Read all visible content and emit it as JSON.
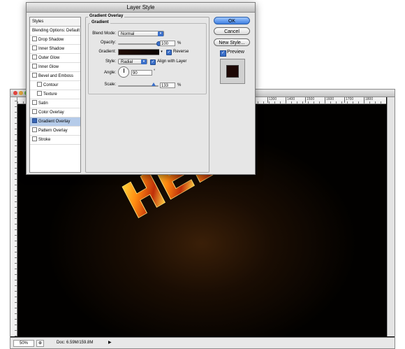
{
  "dialog": {
    "title": "Layer Style",
    "styles_header": "Styles",
    "styles": [
      {
        "label": "Blending Options: Default",
        "checkbox": false,
        "sub": false,
        "selected": false,
        "checked": false
      },
      {
        "label": "Drop Shadow",
        "checkbox": true,
        "sub": false,
        "selected": false,
        "checked": false
      },
      {
        "label": "Inner Shadow",
        "checkbox": true,
        "sub": false,
        "selected": false,
        "checked": false
      },
      {
        "label": "Outer Glow",
        "checkbox": true,
        "sub": false,
        "selected": false,
        "checked": false
      },
      {
        "label": "Inner Glow",
        "checkbox": true,
        "sub": false,
        "selected": false,
        "checked": false
      },
      {
        "label": "Bevel and Emboss",
        "checkbox": true,
        "sub": false,
        "selected": false,
        "checked": false
      },
      {
        "label": "Contour",
        "checkbox": true,
        "sub": true,
        "selected": false,
        "checked": false
      },
      {
        "label": "Texture",
        "checkbox": true,
        "sub": true,
        "selected": false,
        "checked": false
      },
      {
        "label": "Satin",
        "checkbox": true,
        "sub": false,
        "selected": false,
        "checked": false
      },
      {
        "label": "Color Overlay",
        "checkbox": true,
        "sub": false,
        "selected": false,
        "checked": false
      },
      {
        "label": "Gradient Overlay",
        "checkbox": true,
        "sub": false,
        "selected": true,
        "checked": true
      },
      {
        "label": "Pattern Overlay",
        "checkbox": true,
        "sub": false,
        "selected": false,
        "checked": false
      },
      {
        "label": "Stroke",
        "checkbox": true,
        "sub": false,
        "selected": false,
        "checked": false
      }
    ],
    "section_title": "Gradient Overlay",
    "subsection_title": "Gradient",
    "blend_mode_label": "Blend Mode:",
    "blend_mode_value": "Normal",
    "opacity_label": "Opacity:",
    "opacity_value": "100",
    "opacity_unit": "%",
    "gradient_label": "Gradient:",
    "reverse_label": "Reverse",
    "reverse_checked": true,
    "style_label": "Style:",
    "style_value": "Radial",
    "align_label": "Align with Layer",
    "align_checked": true,
    "angle_label": "Angle:",
    "angle_value": "90",
    "angle_unit": "°",
    "scale_label": "Scale:",
    "scale_value": "133",
    "scale_unit": "%",
    "ok_label": "OK",
    "cancel_label": "Cancel",
    "new_style_label": "New Style...",
    "preview_label": "Preview",
    "preview_checked": true
  },
  "document": {
    "ruler_ticks": [
      "1300",
      "1400",
      "1500",
      "1600",
      "1700",
      "1800"
    ],
    "zoom": "50%",
    "doc_size": "Doc: 6.59M/159.8M",
    "status_arrow": "▶",
    "canvas_text": "HELL"
  },
  "colors": {
    "accent": "#3a6fc9",
    "canvas_bg": "#020100",
    "glow": "#3a1f08"
  }
}
